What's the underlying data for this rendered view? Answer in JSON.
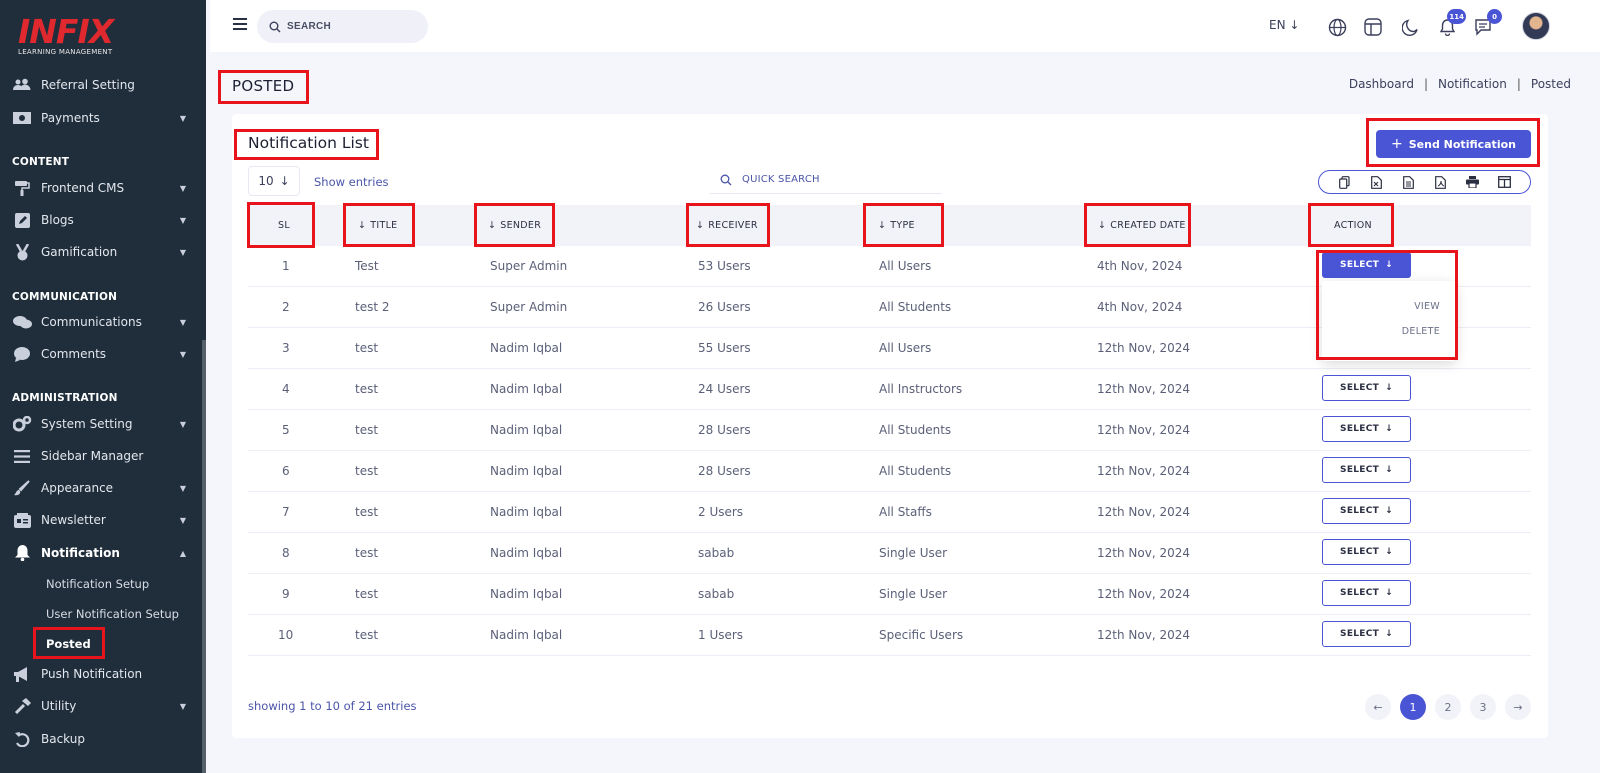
{
  "logo": {
    "text": "INFIX",
    "sub": "LEARNING MANAGEMENT"
  },
  "sidebar": {
    "items": [
      {
        "label": "Referral Setting",
        "icon": "users-icon"
      },
      {
        "label": "Payments",
        "icon": "money-icon"
      },
      {
        "label": "Frontend CMS",
        "icon": "paint-roller-icon"
      },
      {
        "label": "Blogs",
        "icon": "edit-icon"
      },
      {
        "label": "Gamification",
        "icon": "medal-icon"
      },
      {
        "label": "Communications",
        "icon": "chat-icon"
      },
      {
        "label": "Comments",
        "icon": "comment-icon"
      },
      {
        "label": "System Setting",
        "icon": "gears-icon"
      },
      {
        "label": "Sidebar Manager",
        "icon": "bars-icon"
      },
      {
        "label": "Appearance",
        "icon": "brush-icon"
      },
      {
        "label": "Newsletter",
        "icon": "newsletter-icon"
      },
      {
        "label": "Notification",
        "icon": "bell-icon"
      },
      {
        "label": "Push Notification",
        "icon": "megaphone-icon"
      },
      {
        "label": "Utility",
        "icon": "hammer-icon"
      },
      {
        "label": "Backup",
        "icon": "undo-icon"
      }
    ],
    "sections": [
      "CONTENT",
      "COMMUNICATION",
      "ADMINISTRATION"
    ],
    "sub_items": [
      "Notification Setup",
      "User Notification Setup",
      "Posted"
    ]
  },
  "topbar": {
    "search_placeholder": "SEARCH",
    "lang": "EN",
    "notif_count": "114",
    "msg_count": "0"
  },
  "page": {
    "title": "POSTED",
    "breadcrumb": [
      "Dashboard",
      "Notification",
      "Posted"
    ]
  },
  "card": {
    "title": "Notification List",
    "send_label": "Send Notification",
    "page_length": "10",
    "show_entries": "Show entries",
    "quick_search": "QUICK SEARCH",
    "export_icons": [
      "copy-icon",
      "excel-icon",
      "csv-icon",
      "pdf-icon",
      "print-icon",
      "columns-icon"
    ]
  },
  "table": {
    "headers": [
      "SL",
      "TITLE",
      "SENDER",
      "RECEIVER",
      "TYPE",
      "CREATED DATE",
      "ACTION"
    ],
    "rows": [
      {
        "sl": "1",
        "title": "Test",
        "sender": "Super Admin",
        "receiver": "53 Users",
        "type": "All Users",
        "date": "4th Nov, 2024"
      },
      {
        "sl": "2",
        "title": "test 2",
        "sender": "Super Admin",
        "receiver": "26 Users",
        "type": "All Students",
        "date": "4th Nov, 2024"
      },
      {
        "sl": "3",
        "title": "test",
        "sender": "Nadim Iqbal",
        "receiver": "55 Users",
        "type": "All Users",
        "date": "12th Nov, 2024"
      },
      {
        "sl": "4",
        "title": "test",
        "sender": "Nadim Iqbal",
        "receiver": "24 Users",
        "type": "All Instructors",
        "date": "12th Nov, 2024"
      },
      {
        "sl": "5",
        "title": "test",
        "sender": "Nadim Iqbal",
        "receiver": "28 Users",
        "type": "All Students",
        "date": "12th Nov, 2024"
      },
      {
        "sl": "6",
        "title": "test",
        "sender": "Nadim Iqbal",
        "receiver": "28 Users",
        "type": "All Students",
        "date": "12th Nov, 2024"
      },
      {
        "sl": "7",
        "title": "test",
        "sender": "Nadim Iqbal",
        "receiver": "2 Users",
        "type": "All Staffs",
        "date": "12th Nov, 2024"
      },
      {
        "sl": "8",
        "title": "test",
        "sender": "Nadim Iqbal",
        "receiver": "sabab",
        "type": "Single User",
        "date": "12th Nov, 2024"
      },
      {
        "sl": "9",
        "title": "test",
        "sender": "Nadim Iqbal",
        "receiver": "sabab",
        "type": "Single User",
        "date": "12th Nov, 2024"
      },
      {
        "sl": "10",
        "title": "test",
        "sender": "Nadim Iqbal",
        "receiver": "1 Users",
        "type": "Specific Users",
        "date": "12th Nov, 2024"
      }
    ],
    "select_label": "SELECT",
    "dropdown": [
      "VIEW",
      "DELETE"
    ]
  },
  "footer": {
    "showing": "showing 1 to 10 of 21 entries",
    "pages": [
      "1",
      "2",
      "3"
    ]
  },
  "colors": {
    "sidebar": "#202e3b",
    "accent": "#4a55d6",
    "annotation": "#e8141c"
  }
}
